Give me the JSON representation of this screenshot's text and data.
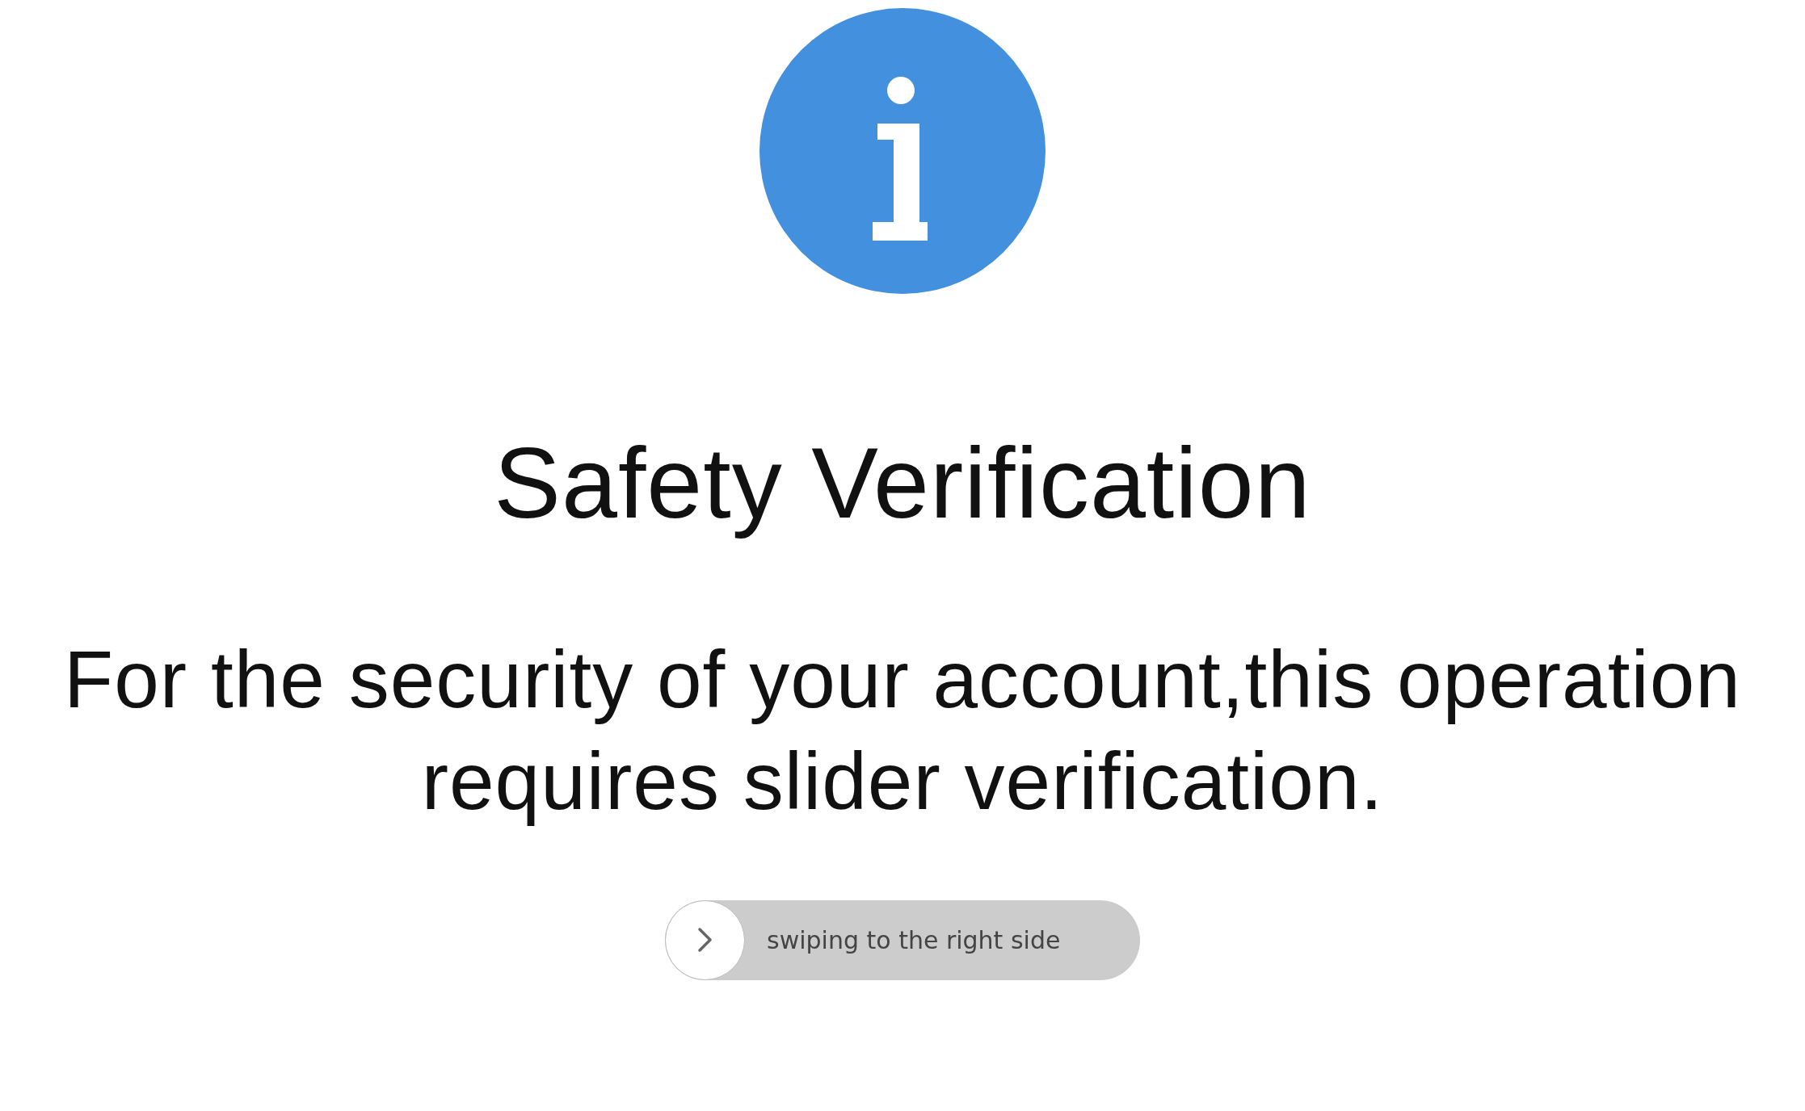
{
  "title": "Safety Verification",
  "message": "For the security of your account,this operation requires slider verification.",
  "slider": {
    "label": "swiping to the right side",
    "level": 0
  }
}
